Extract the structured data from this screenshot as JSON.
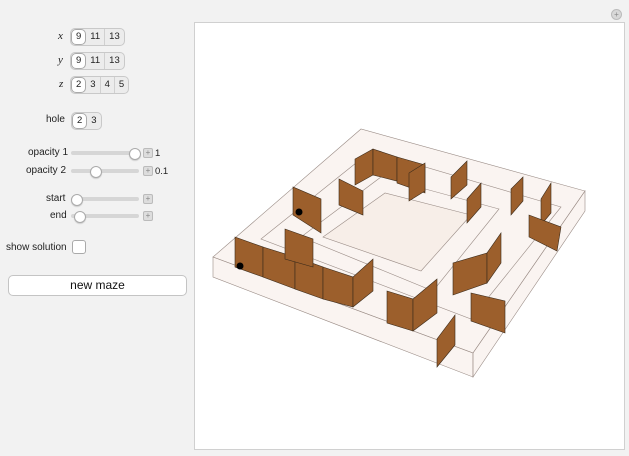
{
  "controls": {
    "x": {
      "label": "x",
      "options": [
        "9",
        "11",
        "13"
      ],
      "selected": "9"
    },
    "y": {
      "label": "y",
      "options": [
        "9",
        "11",
        "13"
      ],
      "selected": "9"
    },
    "z": {
      "label": "z",
      "options": [
        "2",
        "3",
        "4",
        "5"
      ],
      "selected": "2"
    },
    "hole": {
      "label": "hole",
      "options": [
        "2",
        "3"
      ],
      "selected": "2"
    },
    "opacity1": {
      "label": "opacity 1",
      "value": "1",
      "level": 1.0
    },
    "opacity2": {
      "label": "opacity 2",
      "value": "0.1",
      "level": 0.1
    },
    "start": {
      "label": "start",
      "level": 0.0
    },
    "end": {
      "label": "end",
      "level": 0.0
    },
    "show_solution": {
      "label": "show solution",
      "checked": false
    },
    "new_maze": {
      "label": "new maze"
    }
  },
  "colors": {
    "wall": "#9c5f2c",
    "wall_edge": "#3a2a1a",
    "glass": "#f4e7e0",
    "glass_edge": "#9a8c86"
  },
  "icons": {
    "corner": "plus-icon"
  }
}
